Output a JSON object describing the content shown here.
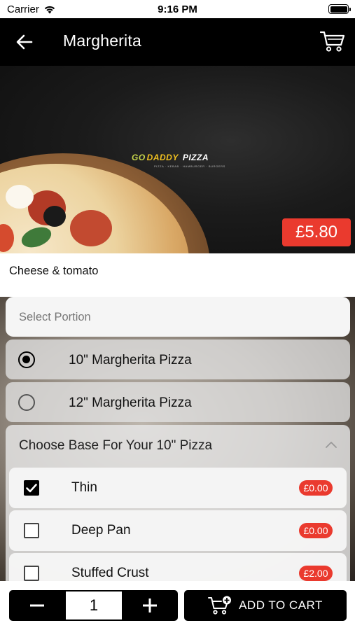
{
  "status_bar": {
    "carrier": "Carrier",
    "time": "9:16 PM"
  },
  "nav": {
    "title": "Margherita"
  },
  "hero": {
    "logo_go": "GO",
    "logo_daddy": "DADDY",
    "logo_pizza": "PIZZA",
    "logo_tagline": "PIZZA · KEBAB · HAMBURGER · BURGERS",
    "price": "£5.80"
  },
  "product": {
    "description": "Cheese & tomato"
  },
  "portion": {
    "placeholder": "Select Portion",
    "options": [
      {
        "label": "10\" Margherita Pizza",
        "selected": true
      },
      {
        "label": "12\" Margherita Pizza",
        "selected": false
      }
    ]
  },
  "base": {
    "title": "Choose Base For Your 10\" Pizza",
    "options": [
      {
        "label": "Thin",
        "price": "£0.00",
        "checked": true
      },
      {
        "label": "Deep Pan",
        "price": "£0.00",
        "checked": false
      },
      {
        "label": "Stuffed Crust",
        "price": "£2.00",
        "checked": false
      }
    ]
  },
  "cart": {
    "quantity": "1",
    "minus": "−",
    "plus": "+",
    "add_label": "ADD TO CART"
  },
  "colors": {
    "accent": "#ea3a2e",
    "nav": "#000000"
  }
}
